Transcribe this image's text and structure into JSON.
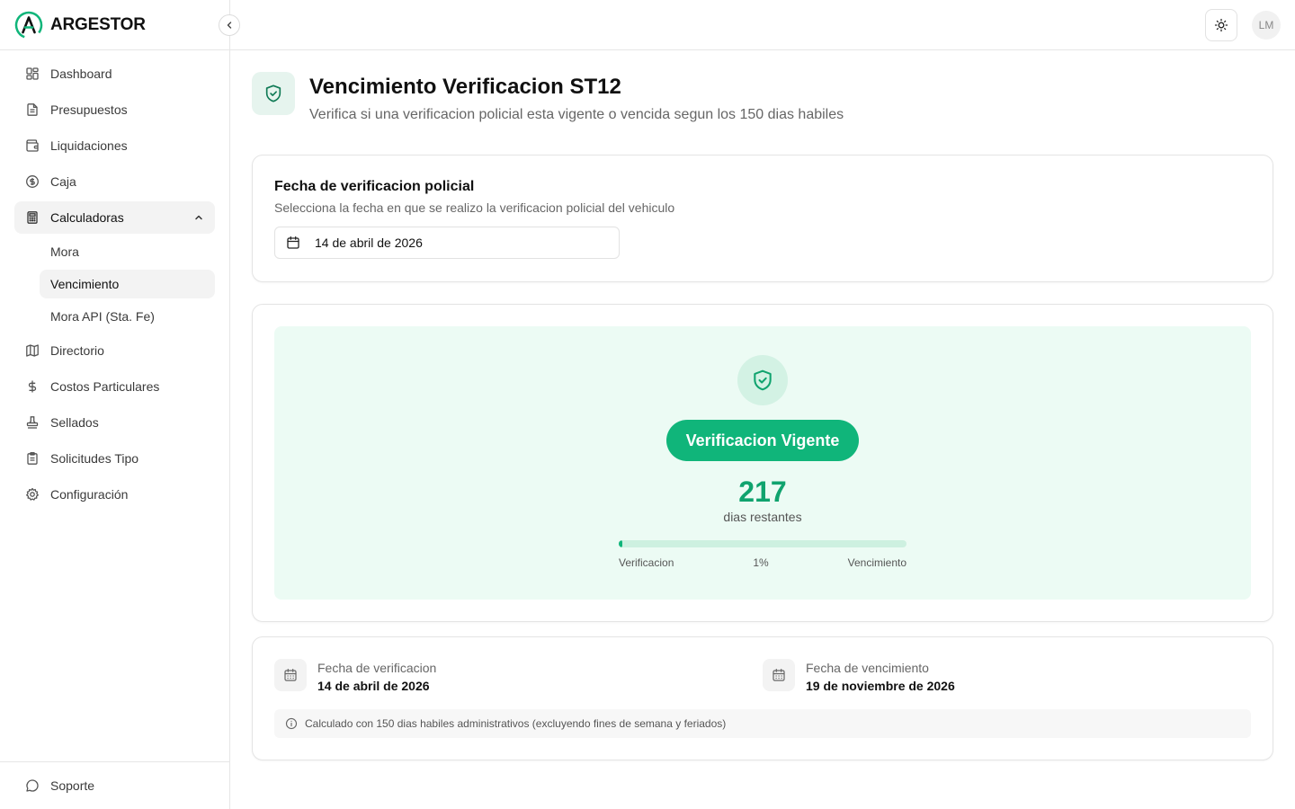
{
  "brand": {
    "name": "ARGESTOR",
    "accent": "#10b57a"
  },
  "sidebar": {
    "items": [
      {
        "label": "Dashboard",
        "icon": "dashboard-icon"
      },
      {
        "label": "Presupuestos",
        "icon": "file-text-icon"
      },
      {
        "label": "Liquidaciones",
        "icon": "wallet-icon"
      },
      {
        "label": "Caja",
        "icon": "dollar-circle-icon"
      },
      {
        "label": "Calculadoras",
        "icon": "calculator-icon",
        "expanded": true
      },
      {
        "label": "Directorio",
        "icon": "map-icon"
      },
      {
        "label": "Costos Particulares",
        "icon": "dollar-icon"
      },
      {
        "label": "Sellados",
        "icon": "stamp-icon"
      },
      {
        "label": "Solicitudes Tipo",
        "icon": "clipboard-icon"
      },
      {
        "label": "Configuración",
        "icon": "gear-icon"
      }
    ],
    "sub_items": [
      {
        "label": "Mora"
      },
      {
        "label": "Vencimiento",
        "active": true
      },
      {
        "label": "Mora API (Sta. Fe)"
      }
    ],
    "footer": {
      "label": "Soporte",
      "icon": "chat-icon"
    }
  },
  "topbar": {
    "avatar_initials": "LM",
    "theme_icon": "sun-icon"
  },
  "page": {
    "title": "Vencimiento Verificacion ST12",
    "subtitle": "Verifica si una verificacion policial esta vigente o vencida segun los 150 dias habiles"
  },
  "date_card": {
    "title": "Fecha de verificacion policial",
    "description": "Selecciona la fecha en que se realizo la verificacion policial del vehiculo",
    "value": "14 de abril de 2026"
  },
  "result": {
    "status": "Verificacion Vigente",
    "days": "217",
    "days_label": "dias restantes",
    "progress_fraction": 0.01,
    "progress_start_label": "Verificacion",
    "progress_percent_label": "1%",
    "progress_end_label": "Vencimiento"
  },
  "info": {
    "verification_label": "Fecha de verificacion",
    "verification_value": "14 de abril de 2026",
    "expiry_label": "Fecha de vencimiento",
    "expiry_value": "19 de noviembre de 2026",
    "note": "Calculado con 150 dias habiles administrativos (excluyendo fines de semana y feriados)"
  }
}
